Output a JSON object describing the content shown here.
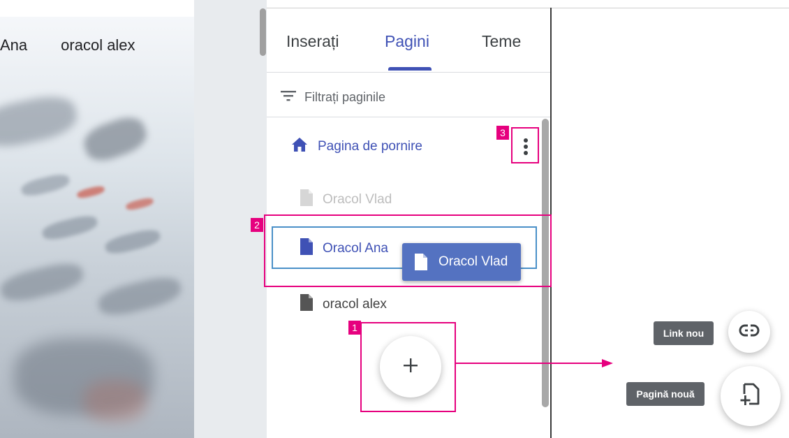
{
  "preview": {
    "nav_items": [
      "Ana",
      "oracol alex"
    ]
  },
  "tabs": [
    {
      "label": "Inserați",
      "active": false
    },
    {
      "label": "Pagini",
      "active": true
    },
    {
      "label": "Teme",
      "active": false
    }
  ],
  "filter": {
    "label": "Filtrați paginile",
    "icon": "filter-icon"
  },
  "pages": [
    {
      "label": "Pagina de pornire",
      "icon": "home-icon",
      "state": "home"
    },
    {
      "label": "Oracol Vlad",
      "icon": "page-icon",
      "state": "dragging-placeholder"
    },
    {
      "label": "Oracol Ana",
      "icon": "page-icon",
      "state": "selected"
    },
    {
      "label": "oracol alex",
      "icon": "page-icon",
      "state": "normal"
    }
  ],
  "drag_chip": {
    "label": "Oracol Vlad",
    "icon": "page-icon"
  },
  "menu": {
    "icon": "more-vert-icon"
  },
  "fab": {
    "icon": "plus-icon"
  },
  "speed_dial": {
    "new_link_label": "Link nou",
    "new_link_icon": "link-icon",
    "new_page_label": "Pagină nouă",
    "new_page_icon": "add-page-icon"
  },
  "callouts": [
    "1",
    "2",
    "3"
  ],
  "colors": {
    "accent": "#3f51b5",
    "page_icon_active": "#3f51b5",
    "callout": "#e6007e",
    "drag_chip": "#5472c1",
    "selection_border": "#4a90c8",
    "tooltip_bg": "#5f6368"
  }
}
